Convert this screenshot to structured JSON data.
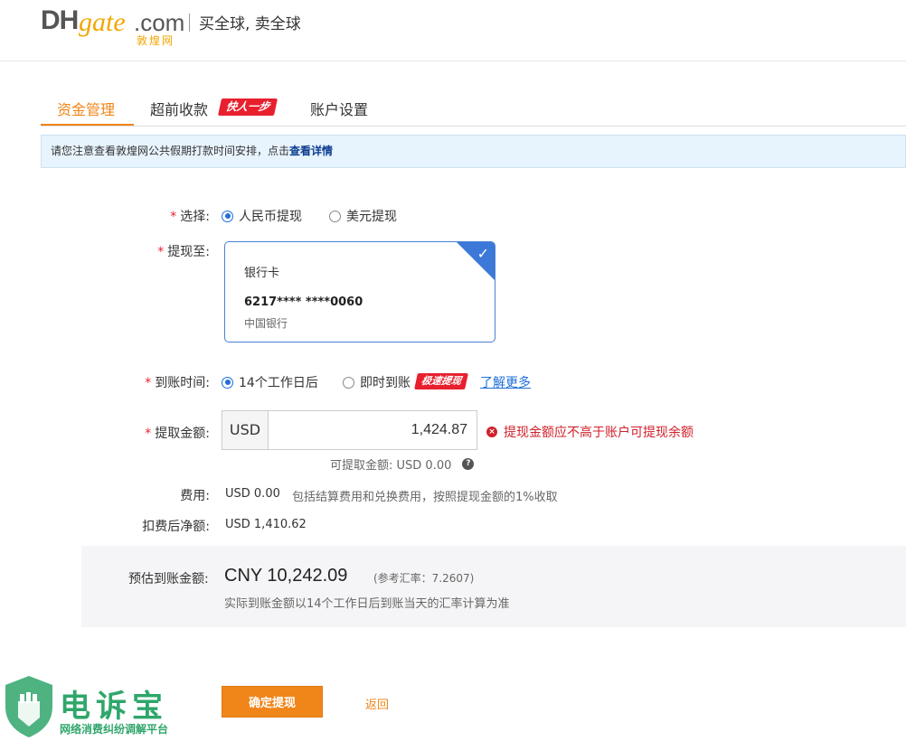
{
  "header": {
    "logo_dh": "DH",
    "logo_gate": "gate",
    "logo_com": ".com",
    "logo_cn": "敦煌网",
    "slogan": "买全球, 卖全球"
  },
  "tabs": {
    "fund": "资金管理",
    "advance": "超前收款",
    "advance_badge": "快人一步",
    "account": "账户设置"
  },
  "notice": {
    "text": "请您注意查看敦煌网公共假期打款时间安排，点击",
    "link": "查看详情"
  },
  "form": {
    "select_label": "选择:",
    "rmb_option": "人民币提现",
    "usd_option": "美元提现",
    "to_label": "提现至:",
    "card": {
      "type": "银行卡",
      "number": "6217**** ****0060",
      "bank": "中国银行"
    },
    "arrival_label": "到账时间:",
    "arrival_14": "14个工作日后",
    "arrival_instant": "即时到账",
    "speed_badge": "极速提现",
    "learn_more": "了解更多",
    "amount_label": "提取金额:",
    "currency": "USD",
    "amount_value": "1,424.87",
    "error": "提现金额应不高于账户可提现余额",
    "available": "可提取金额: USD 0.00",
    "fee_label": "费用:",
    "fee_value": "USD 0.00",
    "fee_note": "包括结算费用和兑换费用，按照提现金额的1%收取",
    "net_label": "扣费后净额:",
    "net_value": "USD 1,410.62"
  },
  "estimate": {
    "label": "预估到账金额:",
    "amount": "CNY 10,242.09",
    "rate": "(参考汇率：7.2607)",
    "note": "实际到账金额以14个工作日后到账当天的汇率计算为准"
  },
  "actions": {
    "confirm": "确定提现",
    "back": "返回"
  },
  "watermark": {
    "title": "电诉宝",
    "subtitle": "网络消费纠纷调解平台"
  },
  "colors": {
    "accent": "#f08519",
    "link": "#1e6fd9",
    "error": "#d0202a",
    "badge": "#e8202e"
  }
}
